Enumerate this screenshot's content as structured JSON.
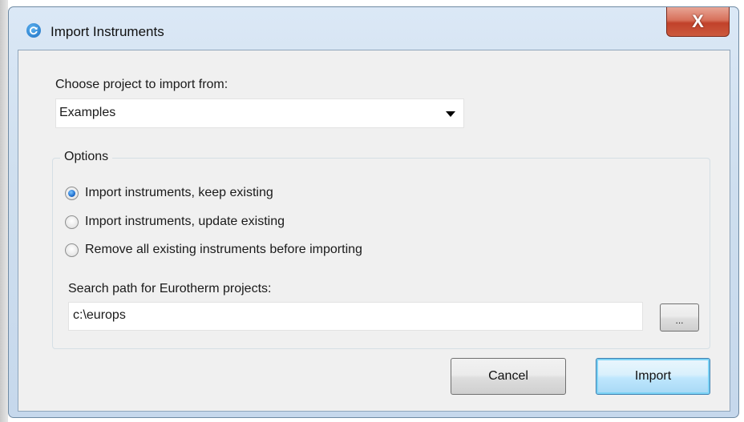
{
  "dialog": {
    "title": "Import Instruments",
    "close_label": "X"
  },
  "project": {
    "label": "Choose project to import from:",
    "selected": "Examples"
  },
  "options": {
    "caption": "Options",
    "radios": [
      {
        "label": "Import instruments, keep existing",
        "checked": true
      },
      {
        "label": "Import instruments, update existing",
        "checked": false
      },
      {
        "label": "Remove all existing instruments before importing",
        "checked": false
      }
    ],
    "search_path_label": "Search path for Eurotherm projects:",
    "search_path_value": "c:\\europs",
    "browse_label": "..."
  },
  "buttons": {
    "cancel": "Cancel",
    "import": "Import"
  },
  "icons": {
    "title_icon": "refresh-icon",
    "close_icon": "close-icon",
    "dropdown_icon": "chevron-down-icon"
  }
}
